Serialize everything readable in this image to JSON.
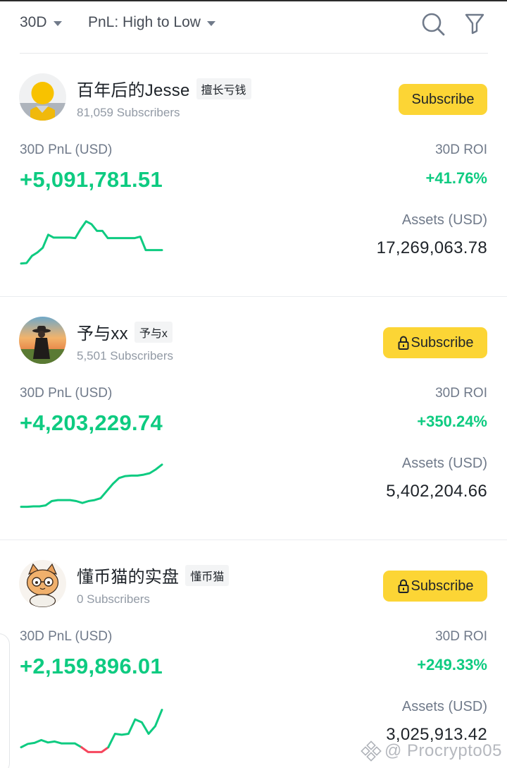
{
  "filters": {
    "period": "30D",
    "sort": "PnL: High to Low"
  },
  "icons": {
    "search": "search-icon",
    "filter": "funnel-icon",
    "dropdown": "caret-down-icon",
    "lock": "lock-icon"
  },
  "colors": {
    "accent_yellow": "#fcd535",
    "profit_green": "#0ecb81",
    "loss_red": "#f6465d",
    "text_primary": "#1e2329",
    "text_secondary": "#707a8a"
  },
  "labels": {
    "pnl": "30D PnL (USD)",
    "roi": "30D ROI",
    "assets": "Assets (USD)"
  },
  "traders": [
    {
      "name": "百年后的Jesse",
      "tag": "擅长亏钱",
      "subscribers": "81,059 Subscribers",
      "subscribe_label": "Subscribe",
      "locked": false,
      "pnl": "+5,091,781.51",
      "roi": "+41.76%",
      "assets": "17,269,063.78",
      "avatar": "yellow-figure-avatar",
      "sparkline": [
        0.02,
        0.03,
        0.18,
        0.25,
        0.35,
        0.62,
        0.56,
        0.56,
        0.56,
        0.56,
        0.55,
        0.74,
        0.9,
        0.84,
        0.7,
        0.7,
        0.55,
        0.55,
        0.55,
        0.55,
        0.55,
        0.55,
        0.58,
        0.3,
        0.3,
        0.3,
        0.3
      ]
    },
    {
      "name": "予与xx",
      "tag": "予与x",
      "subscribers": "5,501 Subscribers",
      "subscribe_label": "Subscribe",
      "locked": true,
      "pnl": "+4,203,229.74",
      "roi": "+350.24%",
      "assets": "5,402,204.66",
      "avatar": "sunset-figure-avatar",
      "sparkline": [
        0.02,
        0.02,
        0.03,
        0.03,
        0.05,
        0.14,
        0.16,
        0.16,
        0.16,
        0.14,
        0.1,
        0.14,
        0.16,
        0.2,
        0.35,
        0.5,
        0.62,
        0.66,
        0.67,
        0.67,
        0.69,
        0.72,
        0.8,
        0.9
      ]
    },
    {
      "name": "懂币猫的实盘",
      "tag": "懂币猫",
      "subscribers": "0 Subscribers",
      "locked": true,
      "subscribe_label": "Subscribe",
      "pnl": "+2,159,896.01",
      "roi": "+249.33%",
      "assets": "3,025,913.42",
      "avatar": "cat-avatar",
      "sparkline": [
        0.08,
        0.15,
        0.17,
        0.23,
        0.18,
        0.2,
        0.16,
        0.16,
        0.16,
        0.08,
        -0.02,
        -0.02,
        -0.02,
        0.08,
        0.36,
        0.34,
        0.36,
        0.66,
        0.6,
        0.36,
        0.52,
        0.86
      ],
      "sparkline_negative_range": [
        9,
        13
      ]
    }
  ],
  "watermark": "@ Procrypto05"
}
